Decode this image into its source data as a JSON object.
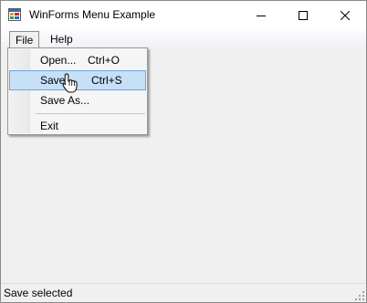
{
  "window": {
    "title": "WinForms Menu Example"
  },
  "caption_buttons": {
    "minimize": "minimize-icon",
    "maximize": "maximize-icon",
    "close": "close-icon"
  },
  "menubar": {
    "items": [
      {
        "label": "File"
      },
      {
        "label": "Help"
      }
    ]
  },
  "file_menu": {
    "items": [
      {
        "label": "Open...",
        "shortcut": "Ctrl+O"
      },
      {
        "label": "Save",
        "shortcut": "Ctrl+S"
      },
      {
        "label": "Save As...",
        "shortcut": ""
      },
      {
        "label": "Exit",
        "shortcut": ""
      }
    ]
  },
  "statusbar": {
    "text": "Save selected"
  },
  "colors": {
    "highlight_fill": "#c6e0f7",
    "highlight_border": "#6ea6d8"
  }
}
